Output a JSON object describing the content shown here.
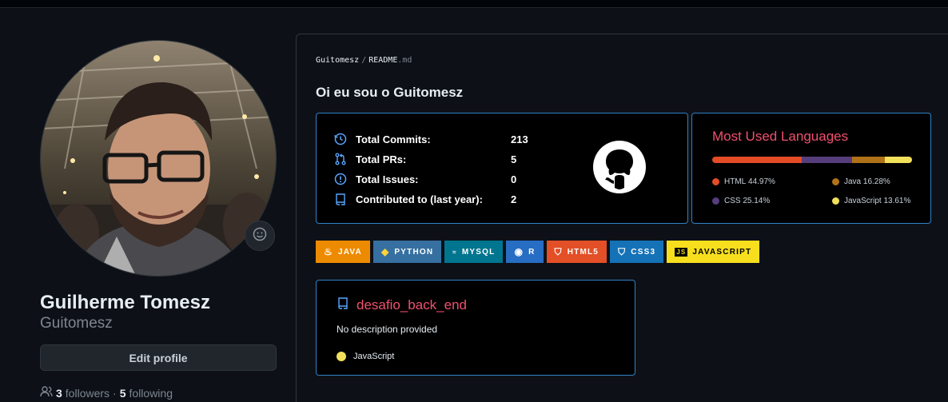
{
  "profile": {
    "full_name": "Guilherme Tomesz",
    "login": "Guitomesz",
    "edit_label": "Edit profile",
    "followers_count": "3",
    "followers_label": "followers",
    "separator": "·",
    "following_count": "5",
    "following_label": "following",
    "status_icon": "smiley-icon"
  },
  "readme": {
    "crumb_user": "Guitomesz",
    "crumb_sep": "/",
    "crumb_file": "README",
    "crumb_ext": ".md",
    "greeting": "Oi eu sou o Guitomesz"
  },
  "stats": {
    "rows": [
      {
        "label": "Total Commits:",
        "value": "213",
        "icon": "history-icon"
      },
      {
        "label": "Total PRs:",
        "value": "5",
        "icon": "pull-request-icon"
      },
      {
        "label": "Total Issues:",
        "value": "0",
        "icon": "issue-icon"
      },
      {
        "label": "Contributed to (last year):",
        "value": "2",
        "icon": "repo-icon"
      }
    ],
    "accent": "#58a6ff"
  },
  "languages": {
    "title": "Most Used Languages",
    "items": [
      {
        "name": "HTML",
        "percent": "44.97%",
        "value": 44.97,
        "color": "#e34c26"
      },
      {
        "name": "Java",
        "percent": "16.28%",
        "value": 16.28,
        "color": "#b07219"
      },
      {
        "name": "CSS",
        "percent": "25.14%",
        "value": 25.14,
        "color": "#563d7c"
      },
      {
        "name": "JavaScript",
        "percent": "13.61%",
        "value": 13.61,
        "color": "#f1e05a"
      }
    ]
  },
  "badges": [
    {
      "label": "JAVA",
      "color": "#ed8b00",
      "icon": "java-icon"
    },
    {
      "label": "PYTHON",
      "color": "#3670a0",
      "icon": "python-icon"
    },
    {
      "label": "MYSQL",
      "color": "#00758f",
      "icon": "mysql-icon"
    },
    {
      "label": "R",
      "color": "#276dc3",
      "icon": "r-icon"
    },
    {
      "label": "HTML5",
      "color": "#e34f26",
      "icon": "html5-icon"
    },
    {
      "label": "CSS3",
      "color": "#1572b6",
      "icon": "css3-icon"
    },
    {
      "label": "JAVASCRIPT",
      "color": "#f7df1e",
      "icon": "javascript-icon"
    }
  ],
  "repo": {
    "name": "desafio_back_end",
    "description": "No description provided",
    "language": "JavaScript",
    "language_color": "#f1e05a"
  }
}
